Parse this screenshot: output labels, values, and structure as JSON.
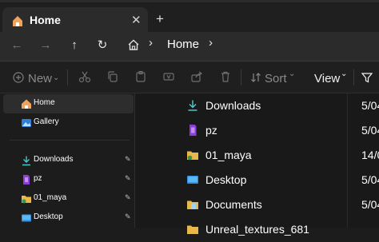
{
  "tab": {
    "title": "Home",
    "close_glyph": "✕",
    "new_tab_glyph": "+"
  },
  "navigation": {
    "back_glyph": "←",
    "forward_glyph": "→",
    "up_glyph": "↑",
    "refresh_glyph": "↻"
  },
  "address": {
    "separator": "›",
    "location": "Home"
  },
  "toolbar": {
    "new_label": "New",
    "sort_label": "Sort",
    "view_label": "View",
    "icons": [
      "cut-icon",
      "copy-icon",
      "paste-icon",
      "rename-icon",
      "share-icon",
      "delete-icon",
      "filter-icon"
    ]
  },
  "sidebar": {
    "items": [
      {
        "label": "Home",
        "icon": "home-icon",
        "selected": true
      },
      {
        "label": "Gallery",
        "icon": "gallery-icon",
        "selected": false
      },
      {
        "label": "Downloads",
        "icon": "download-icon",
        "pinned": true
      },
      {
        "label": "pz",
        "icon": "purple-file-icon",
        "pinned": true
      },
      {
        "label": "01_maya",
        "icon": "folder-icon",
        "pinned": true
      },
      {
        "label": "Desktop",
        "icon": "desktop-icon",
        "pinned": true
      }
    ],
    "pin_glyph": "📌"
  },
  "files": [
    {
      "name": "Downloads",
      "icon": "download-icon",
      "date": "5/04"
    },
    {
      "name": "pz",
      "icon": "purple-file-icon",
      "date": "5/04"
    },
    {
      "name": "01_maya",
      "icon": "folder-icon",
      "date": "14/0"
    },
    {
      "name": "Desktop",
      "icon": "desktop-icon",
      "date": "5/04"
    },
    {
      "name": "Documents",
      "icon": "document-icon",
      "date": "5/04"
    },
    {
      "name": "Unreal_textures_681",
      "icon": "folder-icon",
      "date": ""
    }
  ],
  "colors": {
    "accent": "#4cc2ff",
    "folder": "#e8b84a",
    "selected": "#2d2d2d"
  }
}
